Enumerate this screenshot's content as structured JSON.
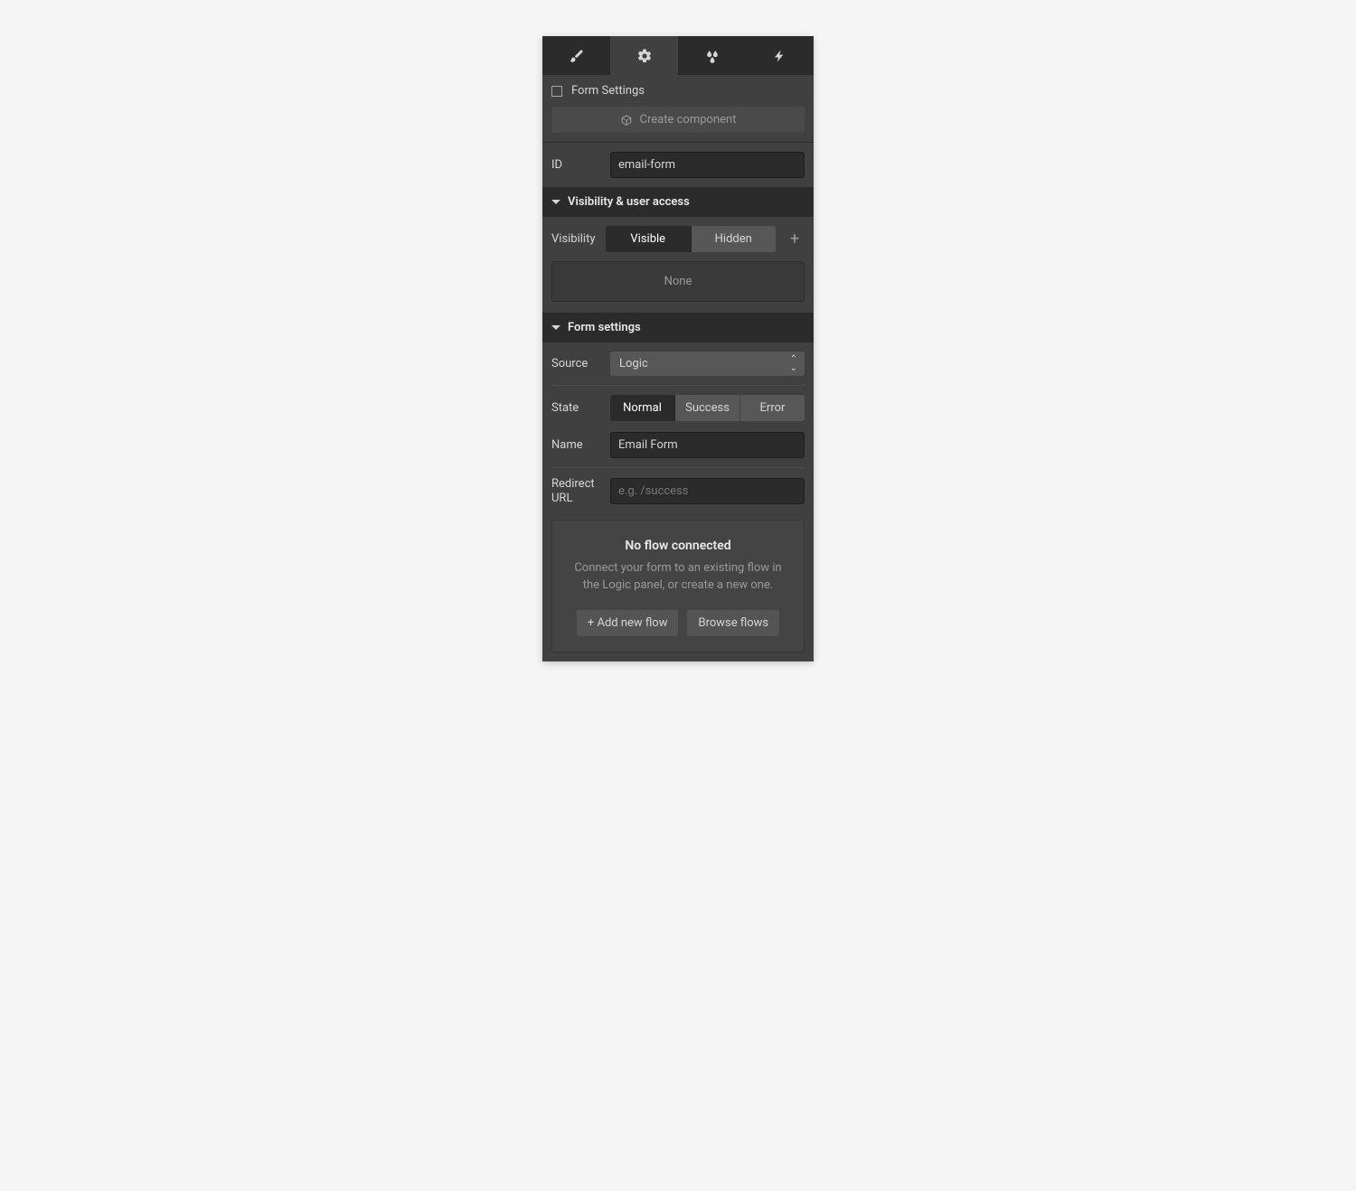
{
  "tabs": {
    "items": [
      "style",
      "settings",
      "effects",
      "interactions"
    ],
    "active_index": 1
  },
  "header": {
    "title": "Form Settings",
    "create_component_label": "Create component"
  },
  "id_field": {
    "label": "ID",
    "value": "email-form"
  },
  "visibility_section": {
    "title": "Visibility & user access",
    "label": "Visibility",
    "options": [
      "Visible",
      "Hidden"
    ],
    "active_index": 0,
    "none_label": "None"
  },
  "form_settings_section": {
    "title": "Form settings",
    "source": {
      "label": "Source",
      "value": "Logic"
    },
    "state": {
      "label": "State",
      "options": [
        "Normal",
        "Success",
        "Error"
      ],
      "active_index": 0
    },
    "name": {
      "label": "Name",
      "value": "Email Form"
    },
    "redirect": {
      "label": "Redirect URL",
      "placeholder": "e.g. /success",
      "value": ""
    }
  },
  "empty_state": {
    "title": "No flow connected",
    "description": "Connect your form to an existing flow in the Logic panel, or create a new one.",
    "add_btn": "+ Add new flow",
    "browse_btn": "Browse flows"
  }
}
